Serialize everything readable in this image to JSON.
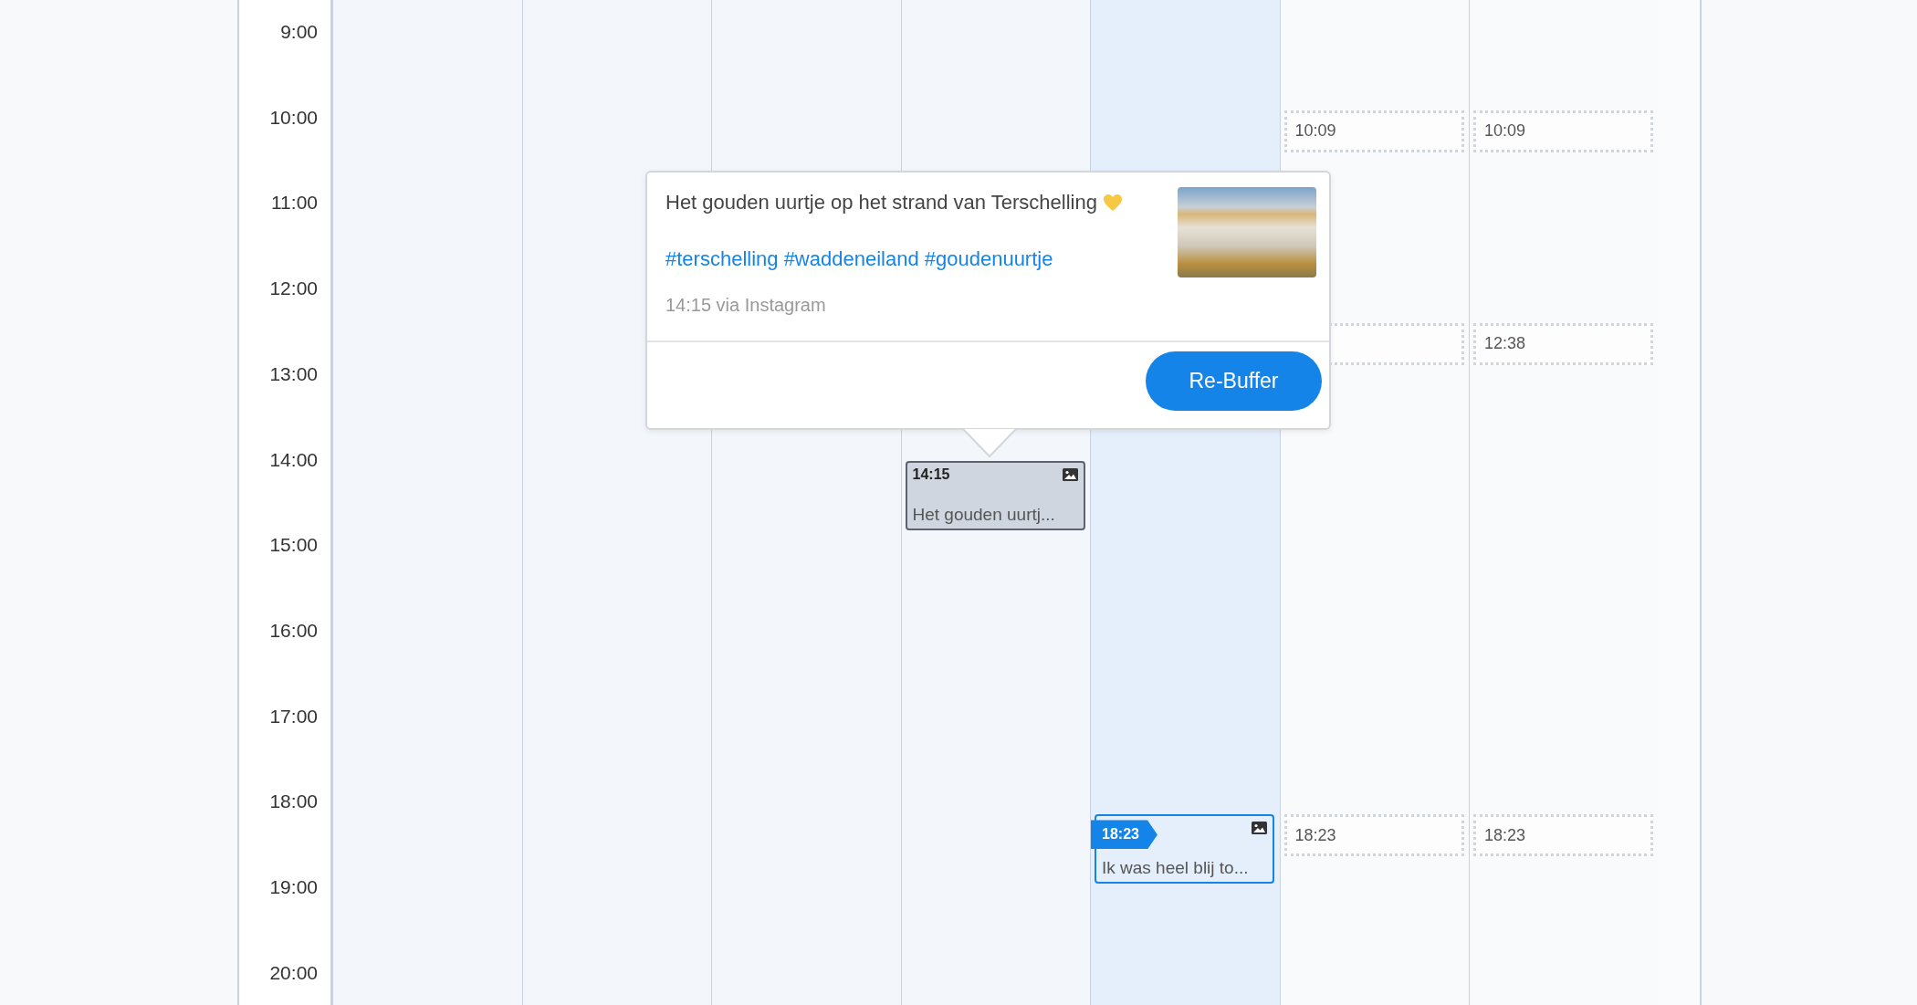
{
  "hours": [
    "9:00",
    "10:00",
    "11:00",
    "12:00",
    "13:00",
    "14:00",
    "15:00",
    "16:00",
    "17:00",
    "18:00",
    "19:00",
    "20:00"
  ],
  "days": [
    {
      "kind": "past"
    },
    {
      "kind": "past"
    },
    {
      "kind": "past"
    },
    {
      "kind": "past",
      "items": [
        {
          "kind": "post",
          "selected": true,
          "time": "14:15",
          "text": "Het gouden uurtj...",
          "has_image": true
        }
      ]
    },
    {
      "kind": "today",
      "items": [
        {
          "kind": "post",
          "selected": false,
          "time": "18:23",
          "text": "Ik was heel blij to...",
          "has_image": true
        }
      ]
    },
    {
      "kind": "future",
      "items": [
        {
          "kind": "slot",
          "time": "10:09"
        },
        {
          "kind": "slot"
        },
        {
          "kind": "slot",
          "time": "18:23"
        }
      ]
    },
    {
      "kind": "future",
      "items": [
        {
          "kind": "slot",
          "time": "10:09"
        },
        {
          "kind": "slot",
          "time": "12:38"
        },
        {
          "kind": "slot",
          "time": "18:23"
        }
      ]
    }
  ],
  "popover": {
    "text": "Het gouden uurtje op het strand van Terschelling",
    "hashtags": "#terschelling #waddeneiland #goudenuurtje",
    "meta": "14:15 via Instagram",
    "button": "Re-Buffer"
  }
}
